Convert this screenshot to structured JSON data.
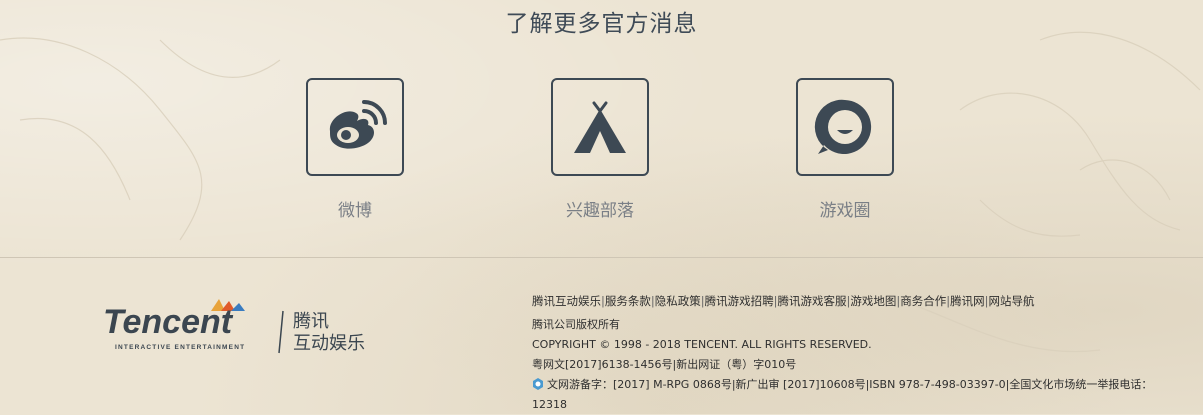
{
  "section": {
    "title": "了解更多官方消息"
  },
  "social": [
    {
      "label": "微博",
      "icon": "weibo-icon"
    },
    {
      "label": "兴趣部落",
      "icon": "tent-icon"
    },
    {
      "label": "游戏圈",
      "icon": "chat-bubble-icon"
    }
  ],
  "logo": {
    "wordmark": "Tencent",
    "tagline": "INTERACTIVE ENTERTAINMENT",
    "cn_line1": "腾讯",
    "cn_line2": "互动娱乐"
  },
  "footer": {
    "links": [
      "腾讯互动娱乐",
      "服务条款",
      "隐私政策",
      "腾讯游戏招聘",
      "腾讯游戏客服",
      "游戏地图",
      "商务合作",
      "腾讯网",
      "网站导航"
    ],
    "copyright_cn": "腾讯公司版权所有",
    "copyright_en": "COPYRIGHT © 1998 - 2018 TENCENT. ALL RIGHTS RESERVED.",
    "license1": "粤网文[2017]6138-1456号|新出网证（粤）字010号",
    "license2": "文网游备字：[2017] M-RPG 0868号|新广出审 [2017]10608号|ISBN 978-7-498-03397-0|全国文化市场统一举报电话：",
    "license2_cont": "12318"
  },
  "colors": {
    "icon": "#3d4954",
    "title": "#3f4b57",
    "label": "#7a7f86",
    "background": "#ece4d3"
  }
}
